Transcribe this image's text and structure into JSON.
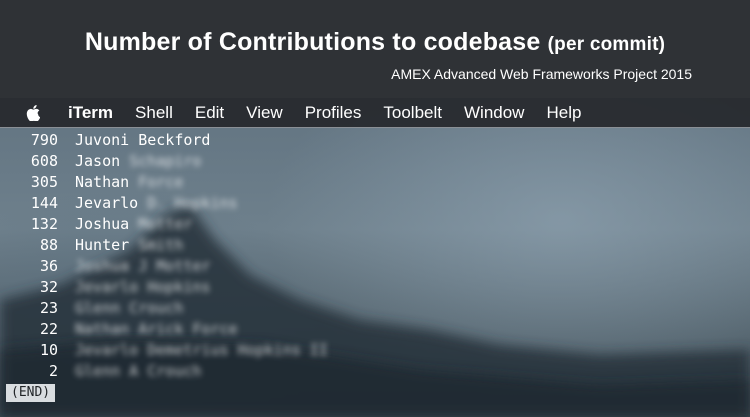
{
  "header": {
    "title": "Number of Contributions to codebase",
    "title_suffix": "(per commit)",
    "subtitle": "AMEX Advanced Web Frameworks Project 2015"
  },
  "menubar": {
    "apple_icon": "apple-icon",
    "items": [
      "iTerm",
      "Shell",
      "Edit",
      "View",
      "Profiles",
      "Toolbelt",
      "Window",
      "Help"
    ]
  },
  "terminal": {
    "rows": [
      {
        "count": "790",
        "first": "Juvoni",
        "rest": "Beckford"
      },
      {
        "count": "608",
        "first": "Jason",
        "rest": "Schapiro"
      },
      {
        "count": "305",
        "first": "Nathan",
        "rest": "Force"
      },
      {
        "count": "144",
        "first": "Jevarlo",
        "rest": "D. Hopkins"
      },
      {
        "count": "132",
        "first": "Joshua",
        "rest": "Motter"
      },
      {
        "count": "88",
        "first": "Hunter",
        "rest": "Smith"
      },
      {
        "count": "36",
        "first": "",
        "rest": "Joshua J Motter"
      },
      {
        "count": "32",
        "first": "",
        "rest": "Jevarlo Hopkins"
      },
      {
        "count": "23",
        "first": "",
        "rest": "Glenn Crouch"
      },
      {
        "count": "22",
        "first": "",
        "rest": "Nathan Arick Force"
      },
      {
        "count": "10",
        "first": "",
        "rest": "Jevarlo Demetrius Hopkins II"
      },
      {
        "count": "2",
        "first": "",
        "rest": "Glenn A Crouch"
      }
    ],
    "end_marker": "(END)"
  }
}
